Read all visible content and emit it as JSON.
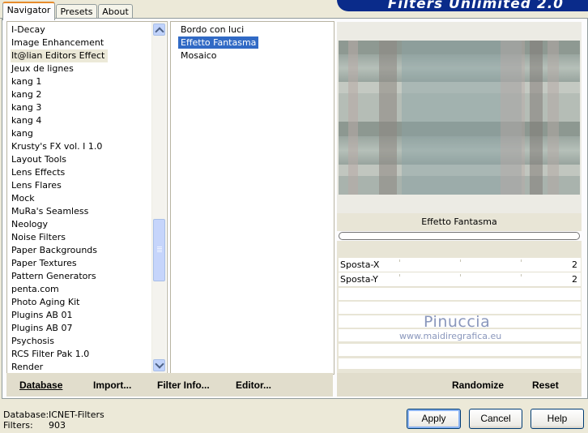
{
  "tabs": [
    {
      "label": "Navigator"
    },
    {
      "label": "Presets"
    },
    {
      "label": "About"
    }
  ],
  "banner": {
    "title": "Filters Unlimited 2.0"
  },
  "categories": [
    "I-Decay",
    "Image Enhancement",
    "It@lian Editors Effect",
    "Jeux de lignes",
    "kang 1",
    "kang 2",
    "kang 3",
    "kang 4",
    "kang",
    "Krusty's FX vol. I 1.0",
    "Layout Tools",
    "Lens Effects",
    "Lens Flares",
    "Mock",
    "MuRa's Seamless",
    "Neology",
    "Noise Filters",
    "Paper Backgrounds",
    "Paper Textures",
    "Pattern Generators",
    "penta.com",
    "Photo Aging Kit",
    "Plugins AB 01",
    "Plugins AB 07",
    "Psychosis",
    "RCS Filter Pak 1.0",
    "Render"
  ],
  "selected_category": "It@lian Editors Effect",
  "filters": [
    "Bordo con luci",
    "Effetto Fantasma",
    "Mosaico"
  ],
  "selected_filter": "Effetto Fantasma",
  "left_toolbar": {
    "database": "Database",
    "import": "Import...",
    "filter_info": "Filter Info...",
    "editor": "Editor..."
  },
  "right_toolbar": {
    "randomize": "Randomize",
    "reset": "Reset"
  },
  "filter_name": "Effetto Fantasma",
  "params": [
    {
      "label": "Sposta-X",
      "value": "2"
    },
    {
      "label": "Sposta-Y",
      "value": "2"
    }
  ],
  "watermark": {
    "name": "Pinuccia",
    "url": "www.maidiregrafica.eu"
  },
  "status": {
    "db_label": "Database:",
    "db_value": "ICNET-Filters",
    "filters_label": "Filters:",
    "filters_value": "903"
  },
  "buttons": {
    "apply": "Apply",
    "cancel": "Cancel",
    "help": "Help"
  },
  "colors": {
    "selection": "#316ac5",
    "banner": "#0a2b8a",
    "tab_accent": "#e68b2c"
  }
}
